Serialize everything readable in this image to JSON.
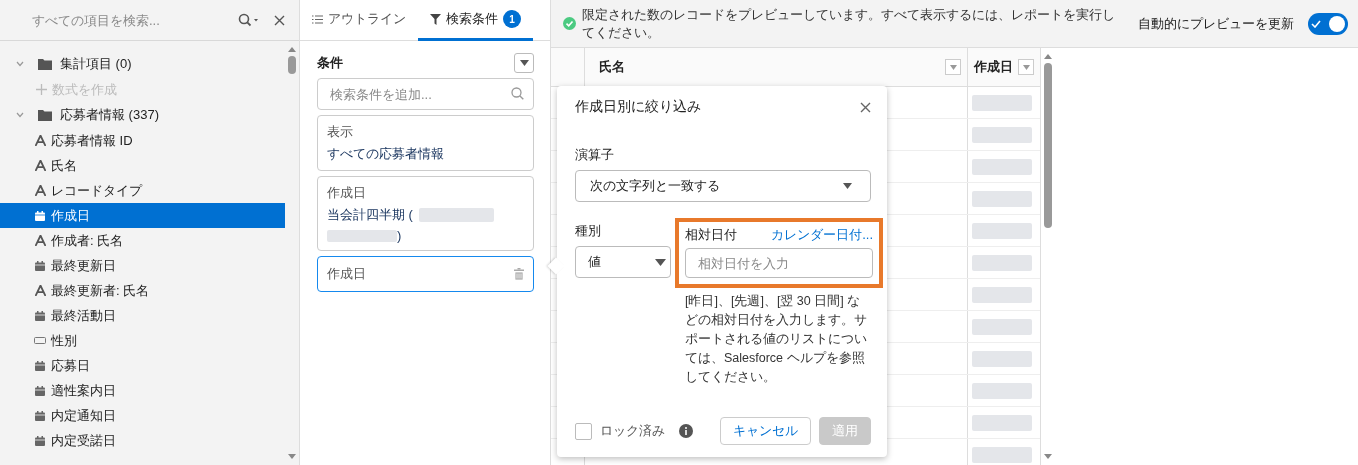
{
  "sidebar": {
    "search": {
      "placeholder": "すべての項目を検索..."
    },
    "groups": [
      {
        "label": "集計項目 (0)",
        "expanded": true,
        "create_action": "数式を作成"
      },
      {
        "label": "応募者情報 (337)",
        "expanded": true,
        "fields": [
          {
            "kind": "text",
            "label": "応募者情報 ID",
            "selected": false
          },
          {
            "kind": "text",
            "label": "氏名",
            "selected": false
          },
          {
            "kind": "text",
            "label": "レコードタイプ",
            "selected": false
          },
          {
            "kind": "date",
            "label": "作成日",
            "selected": true
          },
          {
            "kind": "text",
            "label": "作成者: 氏名",
            "selected": false
          },
          {
            "kind": "date",
            "label": "最終更新日",
            "selected": false
          },
          {
            "kind": "text",
            "label": "最終更新者: 氏名",
            "selected": false
          },
          {
            "kind": "date",
            "label": "最終活動日",
            "selected": false
          },
          {
            "kind": "picklist",
            "label": "性別",
            "selected": false
          },
          {
            "kind": "date",
            "label": "応募日",
            "selected": false
          },
          {
            "kind": "date",
            "label": "適性案内日",
            "selected": false
          },
          {
            "kind": "date",
            "label": "内定通知日",
            "selected": false
          },
          {
            "kind": "date",
            "label": "内定受諾日",
            "selected": false
          }
        ]
      }
    ]
  },
  "tabs": [
    {
      "kind": "outline",
      "label": "アウトライン",
      "selected": false
    },
    {
      "kind": "filters",
      "label": "検索条件",
      "badge": "1",
      "selected": true
    }
  ],
  "filters": {
    "heading": "条件",
    "add_placeholder": "検索条件を追加...",
    "cards": [
      {
        "label": "表示",
        "value": "すべての応募者情報",
        "redacted": false,
        "selected": false
      },
      {
        "label": "作成日",
        "value": "当会計四半期 (",
        "value_tail": ")",
        "redacted": true,
        "selected": false
      },
      {
        "label": "作成日",
        "selected": true,
        "deletable": true
      }
    ]
  },
  "preview": {
    "banner": "限定された数のレコードをプレビューしています。すべて表示するには、レポートを実行してください。",
    "auto_refresh": {
      "label": "自動的にプレビューを更新",
      "on": true
    },
    "columns": [
      "氏名",
      "作成日"
    ]
  },
  "popup": {
    "title": "作成日別に絞り込み",
    "operator": {
      "label": "演算子",
      "value": "次の文字列と一致する"
    },
    "type": {
      "label": "種別",
      "value": "値"
    },
    "relative": {
      "label": "相対日付",
      "link": "カレンダー日付...",
      "placeholder": "相対日付を入力",
      "highlighted": true
    },
    "help": "[昨日]、[先週]、[翌 30 日間] などの相対日付を入力します。サポートされる値のリストについては、Salesforce ヘルプを参照してください。",
    "locked": {
      "label": "ロック済み",
      "checked": false
    },
    "cancel": "キャンセル",
    "apply": {
      "label": "適用",
      "disabled": true
    }
  }
}
